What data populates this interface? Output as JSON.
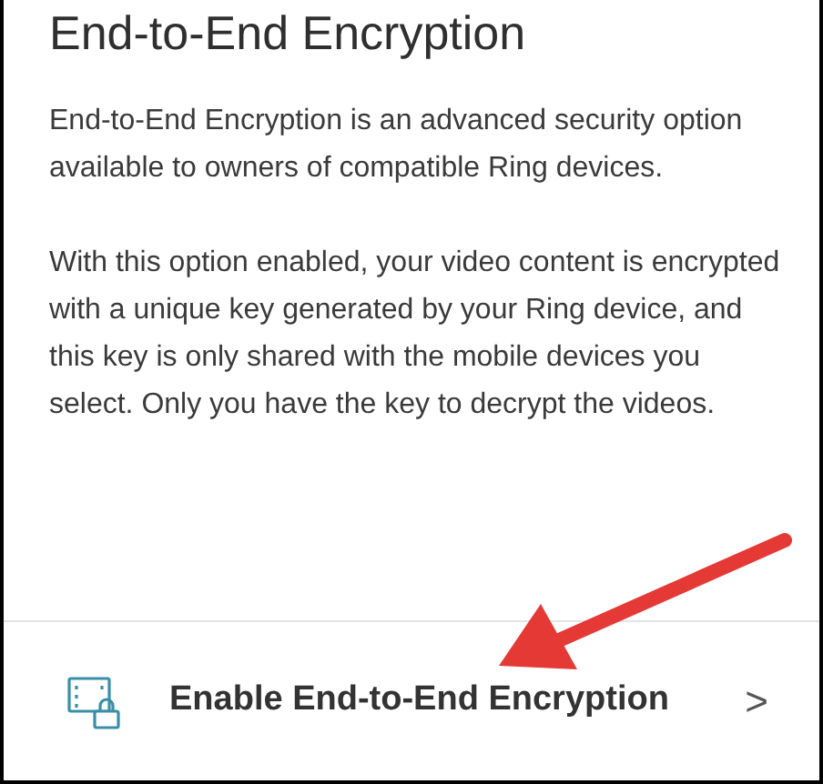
{
  "title": "End-to-End Encryption",
  "paragraphs": [
    "End-to-End Encryption is an advanced security option available to owners of compatible Ring devices.",
    "With this option enabled, your video content is encrypted with a unique key generated by your Ring device, and this key is only shared with the mobile devices you select. Only you have the key to decrypt the videos."
  ],
  "action": {
    "label": "Enable End-to-End Encryption",
    "chevron": ">"
  }
}
